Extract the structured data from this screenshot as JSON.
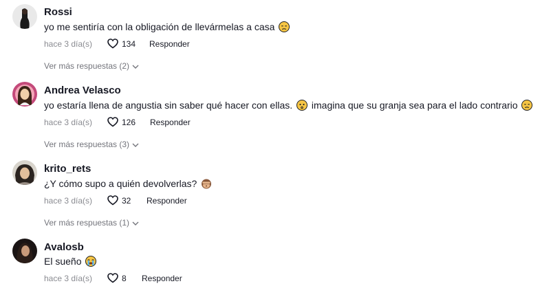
{
  "comments": [
    {
      "username": "Rossi",
      "text": "yo me sentiría con la obligación de llevármelas a casa",
      "emoji": "pensive-face-icon",
      "time": "hace 3 día(s)",
      "likes": "134",
      "reply_label": "Responder",
      "more_replies": "Ver más respuestas (2)"
    },
    {
      "username": "Andrea Velasco",
      "text": "yo estaría llena de angustia sin saber qué hacer con ellas.",
      "emoji": "worried-face-icon",
      "text2": "imagina que su granja sea para el lado contrario",
      "emoji2": "pensive-face-icon",
      "time": "hace 3 día(s)",
      "likes": "126",
      "reply_label": "Responder",
      "more_replies": "Ver más respuestas (3)"
    },
    {
      "username": "krito_rets",
      "text": "¿Y cómo supo a quién devolverlas?",
      "emoji": "see-no-evil-monkey-icon",
      "time": "hace 3 día(s)",
      "likes": "32",
      "reply_label": "Responder",
      "more_replies": "Ver más respuestas (1)"
    },
    {
      "username": "Avalosb",
      "text": "El sueño",
      "emoji": "crying-face-icon",
      "time": "hace 3 día(s)",
      "likes": "8",
      "reply_label": "Responder"
    }
  ],
  "colors": {
    "text": "#161823",
    "muted": "#8a8b91",
    "emoji_yellow": "#f6c544"
  }
}
